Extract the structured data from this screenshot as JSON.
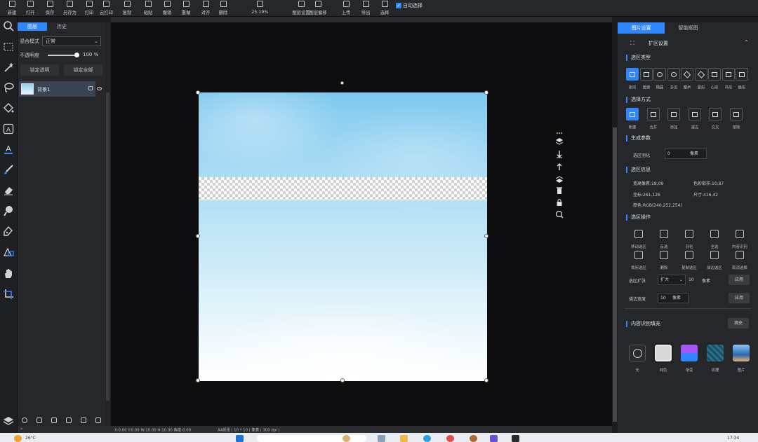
{
  "toolbar": {
    "items": [
      "新建",
      "打开",
      "保存",
      "另存为",
      "打印",
      "云打印",
      "复制",
      "粘贴",
      "撤销",
      "重做",
      "对齐",
      "删除",
      "25.19%",
      "图层设置",
      "图层偏移",
      "上传",
      "导出",
      "选择"
    ],
    "auto_select_label": "自动选择"
  },
  "layers_panel": {
    "tabs": [
      "图层",
      "历史"
    ],
    "blend_label": "混合模式",
    "blend_value": "正常",
    "opacity_label": "不透明度",
    "opacity_value": "100 %",
    "opacity_level": 1.0,
    "btn_left": "锁定透明",
    "btn_right": "锁定全部",
    "layer_name": "背景1"
  },
  "status": {
    "coords": "X:0.00 Y:0.00 W:10.00 H:10.00 角度:0.00",
    "doc": "A4纸张 | 10 * 10 | 像素 | 300 dpi |"
  },
  "right_panel": {
    "tabs": [
      "图片设置",
      "智能抠图"
    ],
    "header_title": "扩区设置",
    "sel_type_title": "选区类型",
    "sel_type_labels": [
      "矩形",
      "套索",
      "椭圆",
      "多边",
      "魔术",
      "星形",
      "心形",
      "鸟形",
      "盾形"
    ],
    "sel_mode_title": "选择方式",
    "sel_mode_labels": [
      "新建",
      "合并",
      "添加",
      "减去",
      "交叉",
      "排除"
    ],
    "gen_params_title": "生成参数",
    "feather_label": "选区羽化",
    "feather_value": "0",
    "feather_unit": "像素",
    "sel_info_title": "选区信息",
    "info": [
      "宽高像素:18,09",
      "色彩取样:10,87",
      "坐标:261,126",
      "尺寸:416,42",
      "颜色:RGB(240,252,254)"
    ],
    "sel_ops_title": "选区操作",
    "ops_row1": [
      "移动选区",
      "反选",
      "羽化",
      "全选",
      "内容识别"
    ],
    "ops_row2": [
      "裁剪选区",
      "删除",
      "复制选区",
      "描边选区",
      "取消选择"
    ],
    "expand_label": "选区扩张",
    "expand_mode": "扩大",
    "expand_value": "10",
    "expand_unit": "像素",
    "apply_label": "应用",
    "stroke_label": "描边宽度",
    "stroke_value": "10",
    "stroke_unit": "像素",
    "apply2_label": "应用",
    "fill_title": "内容识别填充",
    "fill_btn": "填充",
    "fill_labels": [
      "无",
      "纯色",
      "渐变",
      "纹理",
      "图片"
    ],
    "fill_colors": [
      "#2a2b2f",
      "#d8d8d8",
      "#a855f7",
      "#2a6e8a",
      "#4a90c8"
    ]
  },
  "taskbar": {
    "left_text": "26°C",
    "time": "17:34"
  }
}
